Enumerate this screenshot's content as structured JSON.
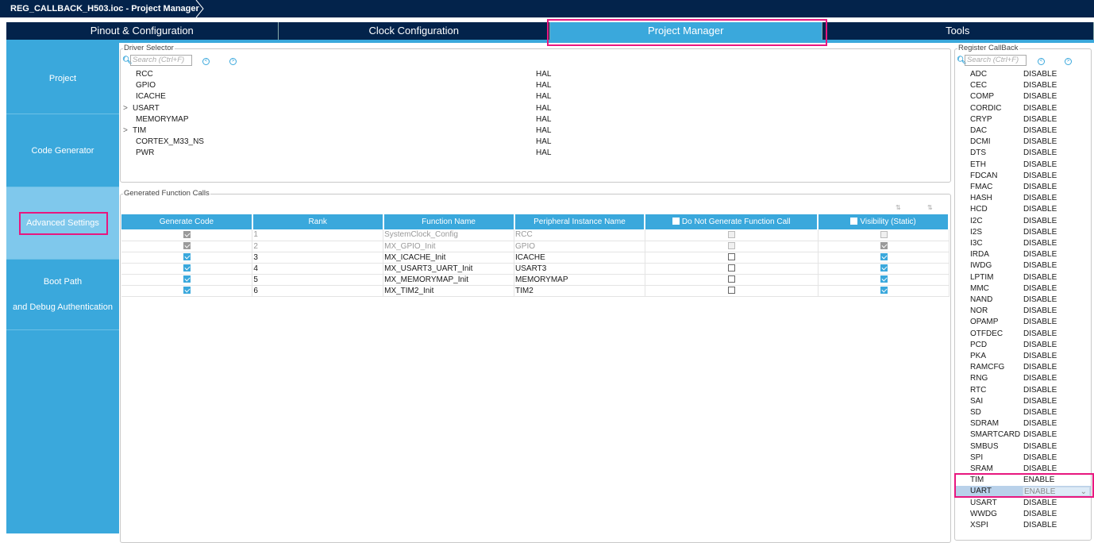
{
  "title": "REG_CALLBACK_H503.ioc - Project Manager",
  "tabs": [
    "Pinout & Configuration",
    "Clock Configuration",
    "Project Manager",
    "Tools"
  ],
  "sidebar": {
    "items": [
      "Project",
      "Code Generator",
      "Advanced Settings",
      "Boot Path",
      "and Debug Authentication"
    ]
  },
  "driver_selector": {
    "legend": "Driver Selector",
    "search_placeholder": "Search (Ctrl+F)",
    "rows": [
      {
        "name": "RCC",
        "value": "HAL",
        "expand": ""
      },
      {
        "name": "GPIO",
        "value": "HAL",
        "expand": ""
      },
      {
        "name": "ICACHE",
        "value": "HAL",
        "expand": ""
      },
      {
        "name": "USART",
        "value": "HAL",
        "expand": ">"
      },
      {
        "name": "MEMORYMAP",
        "value": "HAL",
        "expand": ""
      },
      {
        "name": "TIM",
        "value": "HAL",
        "expand": ">"
      },
      {
        "name": "CORTEX_M33_NS",
        "value": "HAL",
        "expand": ""
      },
      {
        "name": "PWR",
        "value": "HAL",
        "expand": ""
      }
    ]
  },
  "function_calls": {
    "legend": "Generated Function Calls",
    "headers": [
      "Generate Code",
      "Rank",
      "Function Name",
      "Peripheral Instance Name",
      "Do Not Generate Function Call",
      "Visibility (Static)"
    ],
    "rows": [
      {
        "gen": "grey",
        "rank": "1",
        "fn": "SystemClock_Config",
        "inst": "RCC",
        "nogen": "off-dis",
        "vis": "off-dis",
        "disabled": true
      },
      {
        "gen": "grey",
        "rank": "2",
        "fn": "MX_GPIO_Init",
        "inst": "GPIO",
        "nogen": "off-dis",
        "vis": "grey",
        "disabled": true
      },
      {
        "gen": "on",
        "rank": "3",
        "fn": "MX_ICACHE_Init",
        "inst": "ICACHE",
        "nogen": "off",
        "vis": "on",
        "disabled": false
      },
      {
        "gen": "on",
        "rank": "4",
        "fn": "MX_USART3_UART_Init",
        "inst": "USART3",
        "nogen": "off",
        "vis": "on",
        "disabled": false
      },
      {
        "gen": "on",
        "rank": "5",
        "fn": "MX_MEMORYMAP_Init",
        "inst": "MEMORYMAP",
        "nogen": "off",
        "vis": "on",
        "disabled": false
      },
      {
        "gen": "on",
        "rank": "6",
        "fn": "MX_TIM2_Init",
        "inst": "TIM2",
        "nogen": "off",
        "vis": "on",
        "disabled": false
      }
    ]
  },
  "register_callback": {
    "legend": "Register CallBack",
    "search_placeholder": "Search (Ctrl+F)",
    "rows": [
      [
        "ADC",
        "DISABLE"
      ],
      [
        "CEC",
        "DISABLE"
      ],
      [
        "COMP",
        "DISABLE"
      ],
      [
        "CORDIC",
        "DISABLE"
      ],
      [
        "CRYP",
        "DISABLE"
      ],
      [
        "DAC",
        "DISABLE"
      ],
      [
        "DCMI",
        "DISABLE"
      ],
      [
        "DTS",
        "DISABLE"
      ],
      [
        "ETH",
        "DISABLE"
      ],
      [
        "FDCAN",
        "DISABLE"
      ],
      [
        "FMAC",
        "DISABLE"
      ],
      [
        "HASH",
        "DISABLE"
      ],
      [
        "HCD",
        "DISABLE"
      ],
      [
        "I2C",
        "DISABLE"
      ],
      [
        "I2S",
        "DISABLE"
      ],
      [
        "I3C",
        "DISABLE"
      ],
      [
        "IRDA",
        "DISABLE"
      ],
      [
        "IWDG",
        "DISABLE"
      ],
      [
        "LPTIM",
        "DISABLE"
      ],
      [
        "MMC",
        "DISABLE"
      ],
      [
        "NAND",
        "DISABLE"
      ],
      [
        "NOR",
        "DISABLE"
      ],
      [
        "OPAMP",
        "DISABLE"
      ],
      [
        "OTFDEC",
        "DISABLE"
      ],
      [
        "PCD",
        "DISABLE"
      ],
      [
        "PKA",
        "DISABLE"
      ],
      [
        "RAMCFG",
        "DISABLE"
      ],
      [
        "RNG",
        "DISABLE"
      ],
      [
        "RTC",
        "DISABLE"
      ],
      [
        "SAI",
        "DISABLE"
      ],
      [
        "SD",
        "DISABLE"
      ],
      [
        "SDRAM",
        "DISABLE"
      ],
      [
        "SMARTCARD",
        "DISABLE"
      ],
      [
        "SMBUS",
        "DISABLE"
      ],
      [
        "SPI",
        "DISABLE"
      ],
      [
        "SRAM",
        "DISABLE"
      ],
      [
        "TIM",
        "ENABLE"
      ],
      [
        "UART",
        "ENABLE"
      ],
      [
        "USART",
        "DISABLE"
      ],
      [
        "WWDG",
        "DISABLE"
      ],
      [
        "XSPI",
        "DISABLE"
      ]
    ],
    "selected": "UART"
  },
  "colors": {
    "accent": "#3aa8dc",
    "navy": "#03234b",
    "highlight": "#e8177f"
  }
}
